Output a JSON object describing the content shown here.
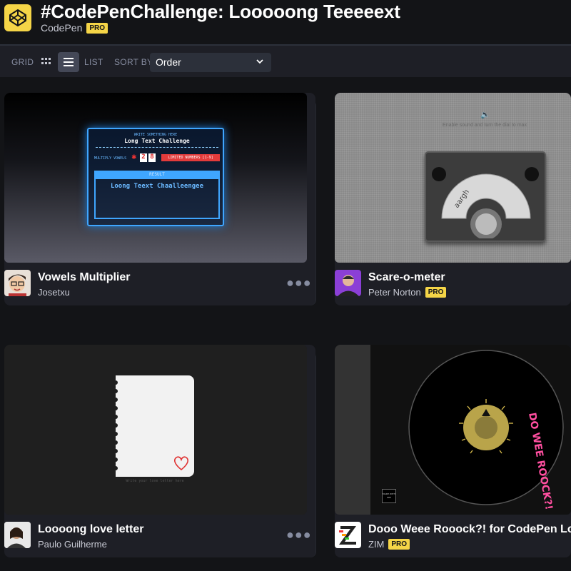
{
  "header": {
    "title": "#CodePenChallenge: Looooong Teeeeext",
    "owner": "CodePen",
    "pro_badge": "PRO"
  },
  "toolbar": {
    "grid_label": "GRID",
    "list_label": "LIST",
    "sort_label": "SORT BY",
    "sort_value": "Order"
  },
  "cards": [
    {
      "title": "Vowels Multiplier",
      "author": "Josetxu",
      "preview": {
        "heading": "WRITE SOMETHING HERE",
        "input_text": "Long Text Challenge",
        "multiply_label": "MULTIPLY VOWELS",
        "digit1": "2",
        "digit2": "8",
        "limited": "LIMITED NUMBERS [1-9]",
        "result_label": "RESULT",
        "result_text": "Loong Teext Chaalleengee"
      }
    },
    {
      "title": "Scare-o-meter",
      "author": "Peter Norton",
      "pro_badge": "PRO",
      "preview": {
        "hint": "Enable sound and turn the dial to max",
        "dial_label": "aargh"
      }
    },
    {
      "title": "Loooong love letter",
      "author": "Paulo Guilherme",
      "preview": {
        "caption": "Write your love letter here"
      }
    },
    {
      "title": "Dooo Weee Rooock?! for CodePen Long T",
      "author": "ZIM",
      "pro_badge": "PRO",
      "preview": {
        "curved_text": "DO WEE ROOCK?!",
        "small_logo": "MADE WITH ZIM"
      }
    }
  ]
}
